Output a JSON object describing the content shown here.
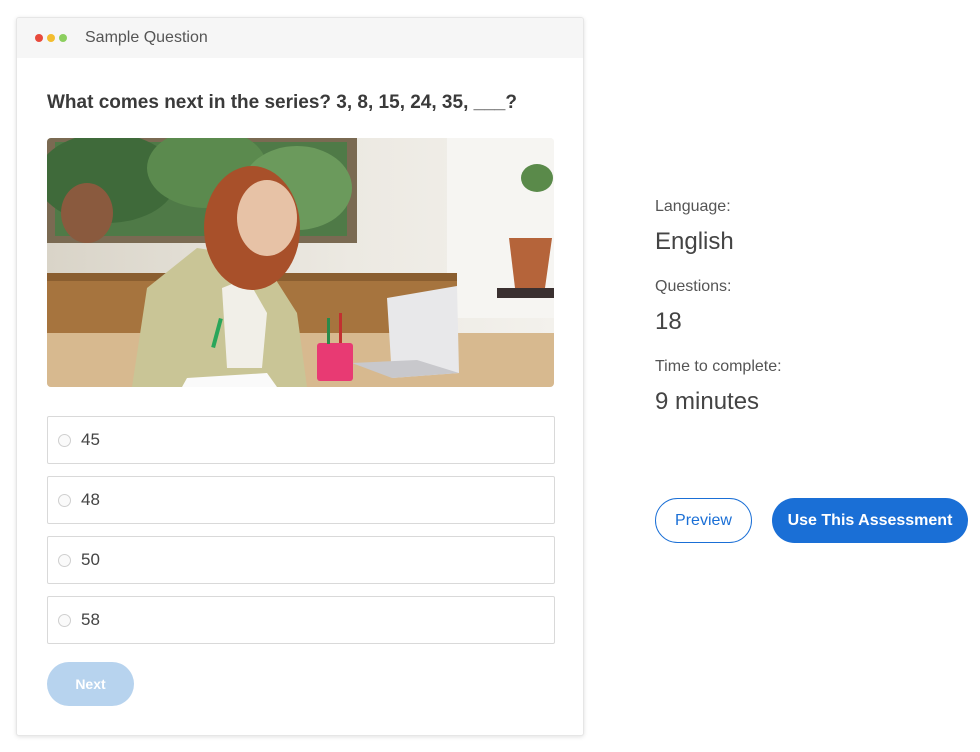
{
  "card": {
    "header_title": "Sample Question",
    "window_dots": [
      "#e84a3c",
      "#f3bd2f",
      "#8ccf5f"
    ]
  },
  "question": {
    "text": "What comes next in the series? 3, 8, 15, 24, 35, ___?",
    "image": "woman-at-laptop-photo",
    "options": [
      {
        "label": "45"
      },
      {
        "label": "48"
      },
      {
        "label": "50"
      },
      {
        "label": "58"
      }
    ],
    "next_label": "Next"
  },
  "info": {
    "language_label": "Language:",
    "language_value": "English",
    "questions_label": "Questions:",
    "questions_value": "18",
    "time_label": "Time to complete:",
    "time_value": "9 minutes"
  },
  "actions": {
    "preview_label": "Preview",
    "use_label": "Use This Assessment"
  },
  "colors": {
    "accent": "#1a6fd6",
    "next_disabled": "#b7d3ee"
  }
}
